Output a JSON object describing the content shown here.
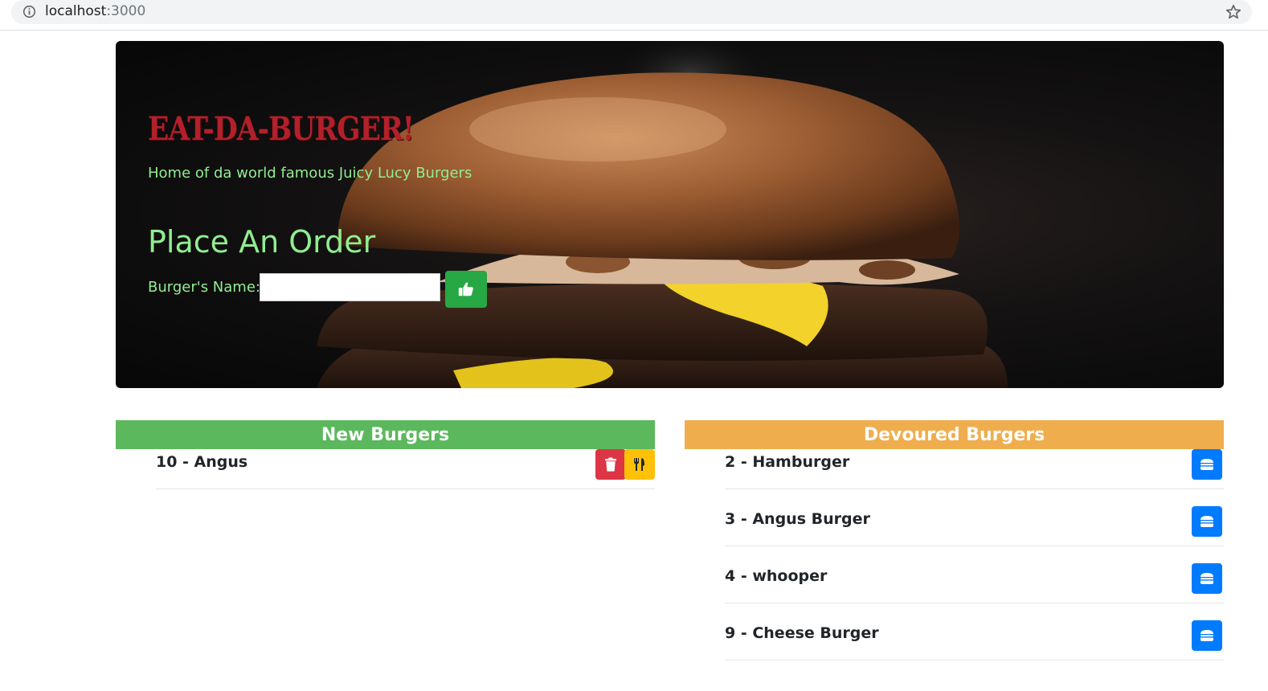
{
  "browser": {
    "url_host": "localhost",
    "url_port": ":3000"
  },
  "header": {
    "title": "EAT-DA-BURGER!",
    "tagline": "Home of da world famous Juicy Lucy Burgers",
    "order_heading": "Place An Order",
    "name_label": "Burger's Name:",
    "name_input_value": "",
    "submit_icon": "thumbs-up-icon"
  },
  "new_burgers": {
    "heading": "New Burgers",
    "items": [
      {
        "label": "10 - Angus",
        "delete_icon": "trash-icon",
        "devour_icon": "utensils-icon"
      }
    ]
  },
  "devoured_burgers": {
    "heading": "Devoured Burgers",
    "items": [
      {
        "label": "2 - Hamburger",
        "icon": "hamburger-icon"
      },
      {
        "label": "3 - Angus Burger",
        "icon": "hamburger-icon"
      },
      {
        "label": "4 - whooper",
        "icon": "hamburger-icon"
      },
      {
        "label": "9 - Cheese Burger",
        "icon": "hamburger-icon"
      }
    ]
  },
  "colors": {
    "title_red": "#b3202a",
    "light_green_text": "#90ee90",
    "new_header_green": "#5cb85c",
    "devoured_header_orange": "#f0ad4e",
    "submit_green": "#28a745",
    "delete_red": "#dc3545",
    "devour_yellow": "#ffc107",
    "action_blue": "#007bff"
  }
}
